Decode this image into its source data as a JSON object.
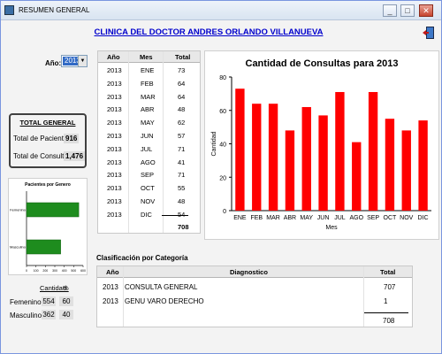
{
  "window": {
    "title": "RESUMEN GENERAL",
    "minimize": "_",
    "maximize": "□",
    "close": "✕"
  },
  "heading": "CLINICA DEL DOCTOR ANDRES ORLANDO VILLANUEVA",
  "year": {
    "label": "Año:",
    "value": "2013"
  },
  "monthly": {
    "headers": [
      "Año",
      "Mes",
      "Total"
    ],
    "rows": [
      [
        "2013",
        "ENE",
        "73"
      ],
      [
        "2013",
        "FEB",
        "64"
      ],
      [
        "2013",
        "MAR",
        "64"
      ],
      [
        "2013",
        "ABR",
        "48"
      ],
      [
        "2013",
        "MAY",
        "62"
      ],
      [
        "2013",
        "JUN",
        "57"
      ],
      [
        "2013",
        "JUL",
        "71"
      ],
      [
        "2013",
        "AGO",
        "41"
      ],
      [
        "2013",
        "SEP",
        "71"
      ],
      [
        "2013",
        "OCT",
        "55"
      ],
      [
        "2013",
        "NOV",
        "48"
      ],
      [
        "2013",
        "DIC",
        "54"
      ]
    ],
    "total": "708"
  },
  "summary": {
    "title": "TOTAL GENERAL",
    "patients_label": "Total de Pacientes:",
    "patients_value": "916",
    "consults_label": "Total de Consultas:",
    "consults_value": "1,476"
  },
  "gender": {
    "qty_header": "Cantidad",
    "pct_header": "%",
    "female_label": "Femenino:",
    "female_qty": "554",
    "female_pct": "60",
    "male_label": "Masculino:",
    "male_qty": "362",
    "male_pct": "40"
  },
  "categories": {
    "title": "Clasificación por Categoría",
    "headers": [
      "Año",
      "Diagnostico",
      "Total"
    ],
    "rows": [
      [
        "2013",
        "CONSULTA GENERAL",
        "707"
      ],
      [
        "2013",
        "GENU VARO DERECHO",
        "1"
      ]
    ],
    "total": "708"
  },
  "chart_data": [
    {
      "type": "bar",
      "title": "Cantidad de Consultas para 2013",
      "xlabel": "Mes",
      "ylabel": "Cantidad",
      "categories": [
        "ENE",
        "FEB",
        "MAR",
        "ABR",
        "MAY",
        "JUN",
        "JUL",
        "AGO",
        "SEP",
        "OCT",
        "NOV",
        "DIC"
      ],
      "values": [
        73,
        64,
        64,
        48,
        62,
        57,
        71,
        41,
        71,
        55,
        48,
        54
      ],
      "ylim": [
        0,
        80
      ],
      "yticks": [
        0,
        20,
        40,
        60,
        80
      ],
      "color": "#ff0000",
      "grid": false
    },
    {
      "type": "bar",
      "orientation": "horizontal",
      "title": "Pacientes por Genero",
      "categories": [
        "Femenino",
        "Masculino"
      ],
      "values": [
        554,
        362
      ],
      "xlim": [
        0,
        600
      ],
      "xticks": [
        0,
        100,
        200,
        300,
        400,
        500,
        600
      ],
      "color": "#1e8c1e",
      "grid": false
    }
  ]
}
